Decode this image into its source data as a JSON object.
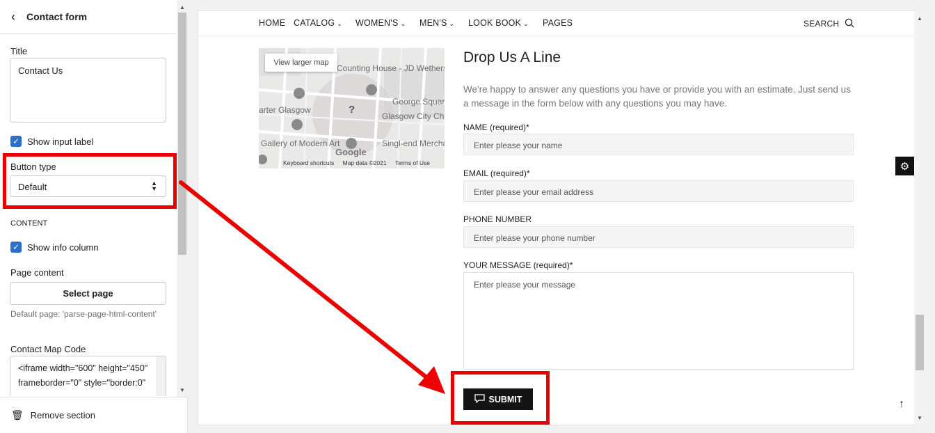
{
  "left_panel": {
    "header_title": "Contact form",
    "title_label": "Title",
    "title_value": "Contact Us",
    "show_input_label": "Show input label",
    "button_type_label": "Button type",
    "button_type_value": "Default",
    "content_heading": "CONTENT",
    "show_info_column": "Show info column",
    "page_content_label": "Page content",
    "select_page_button": "Select page",
    "default_page_hint": "Default page: 'parse-page-html-content'",
    "map_code_label": "Contact Map Code",
    "map_code_value": "<iframe width=\"600\" height=\"450\" frameborder=\"0\" style=\"border:0\"",
    "remove_section": "Remove section"
  },
  "nav": {
    "items": [
      {
        "label": "HOME",
        "dropdown": false
      },
      {
        "label": "CATALOG",
        "dropdown": true
      },
      {
        "label": "WOMEN'S",
        "dropdown": true
      },
      {
        "label": "MEN'S",
        "dropdown": true
      },
      {
        "label": "LOOK BOOK",
        "dropdown": true
      },
      {
        "label": "PAGES",
        "dropdown": false
      }
    ],
    "search_label": "SEARCH"
  },
  "map": {
    "view_larger": "View larger map",
    "labels": [
      "The Counting House - JD Wetherspoon",
      "George Square",
      "Glasgow City Chambers",
      "arter Glasgow",
      "Gallery of Modern Art",
      "Singl-end Merchant City"
    ],
    "google": "Google",
    "footer": [
      "Keyboard shortcuts",
      "Map data ©2021",
      "Terms of Use"
    ]
  },
  "contact": {
    "heading": "Drop Us A Line",
    "intro": "We're happy to answer any questions you have or provide you with an estimate. Just send us a message in the form below with any questions you may have.",
    "name_label": "NAME (required)*",
    "name_placeholder": "Enter please your name",
    "email_label": "EMAIL (required)*",
    "email_placeholder": "Enter please your email address",
    "phone_label": "PHONE NUMBER",
    "phone_placeholder": "Enter please your phone number",
    "message_label": "YOUR MESSAGE (required)*",
    "message_placeholder": "Enter please your message",
    "submit": "SUBMIT"
  },
  "colors": {
    "accent": "#2c6ecb",
    "highlight": "#ee0000",
    "button": "#141414"
  }
}
